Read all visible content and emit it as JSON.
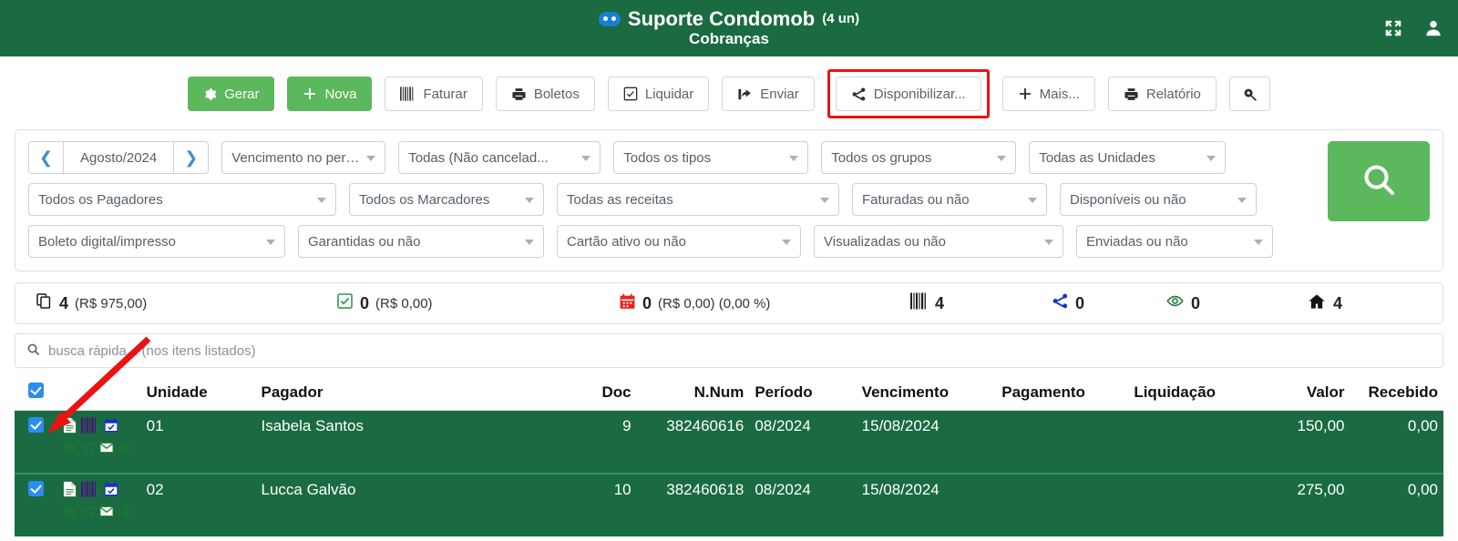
{
  "header": {
    "icon": "game-controller-icon",
    "title": "Suporte Condomob",
    "units": "(4 un)",
    "subtitle": "Cobranças",
    "expand_icon": "expand-arrows-icon",
    "user_icon": "user-icon",
    "bg_color": "#1a6b42"
  },
  "toolbar": {
    "buttons": [
      {
        "label": "Gerar",
        "icon": "gear-icon",
        "style": "green",
        "highlighted": false
      },
      {
        "label": "Nova",
        "icon": "plus-icon",
        "style": "green",
        "highlighted": false
      },
      {
        "label": "Faturar",
        "icon": "barcode-icon",
        "style": "default",
        "highlighted": false
      },
      {
        "label": "Boletos",
        "icon": "printer-icon",
        "style": "default",
        "highlighted": false
      },
      {
        "label": "Liquidar",
        "icon": "checkbox-icon",
        "style": "default",
        "highlighted": false
      },
      {
        "label": "Enviar",
        "icon": "share-out-icon",
        "style": "default",
        "highlighted": false
      },
      {
        "label": "Disponibilizar...",
        "icon": "share-icon",
        "style": "default",
        "highlighted": true
      },
      {
        "label": "Mais...",
        "icon": "plus-icon",
        "style": "default",
        "highlighted": false
      },
      {
        "label": "Relatório",
        "icon": "printer-icon",
        "style": "default",
        "highlighted": false
      },
      {
        "label": "",
        "icon": "search-plus-icon",
        "style": "default",
        "highlighted": false
      }
    ],
    "highlight_color": "#ee1111"
  },
  "filters": {
    "month": "Agosto/2024",
    "prev_icon": "chevron-left-icon",
    "next_icon": "chevron-right-icon",
    "search_button_icon": "search-icon",
    "row1": [
      "Vencimento no perío...",
      "Todas (Não cancelad...",
      "Todos os tipos",
      "Todos os grupos",
      "Todas as Unidades"
    ],
    "row2": [
      "Todos os Pagadores",
      "Todos os Marcadores",
      "Todas as receitas",
      "Faturadas ou não",
      "Disponíveis ou não"
    ],
    "row3": [
      "Boleto digital/impresso",
      "Garantidas ou não",
      "Cartão ativo ou não",
      "Visualizadas ou não",
      "Enviadas ou não"
    ]
  },
  "summary": [
    {
      "icon": "copy-icon",
      "count": "4",
      "detail": "(R$ 975,00)"
    },
    {
      "icon": "check-box-icon",
      "count": "0",
      "detail": "(R$ 0,00)"
    },
    {
      "icon": "calendar-icon",
      "count": "0",
      "detail": "(R$ 0,00) (0,00 %)"
    },
    {
      "icon": "barcode-icon",
      "count": "4",
      "detail": ""
    },
    {
      "icon": "share-icon",
      "count": "0",
      "detail": ""
    },
    {
      "icon": "eye-icon",
      "count": "0",
      "detail": ""
    },
    {
      "icon": "home-icon",
      "count": "4",
      "detail": ""
    }
  ],
  "quick_search": {
    "icon": "search-icon",
    "placeholder": "busca rápida... (nos itens listados)",
    "value": ""
  },
  "table": {
    "header_checkbox_checked": true,
    "columns": [
      {
        "key": "checkbox",
        "label": "",
        "align": "center"
      },
      {
        "key": "icons",
        "label": "",
        "align": "left"
      },
      {
        "key": "unidade",
        "label": "Unidade",
        "align": "left"
      },
      {
        "key": "pagador",
        "label": "Pagador",
        "align": "left"
      },
      {
        "key": "doc",
        "label": "Doc",
        "align": "right"
      },
      {
        "key": "nnum",
        "label": "N.Num",
        "align": "right"
      },
      {
        "key": "periodo",
        "label": "Período",
        "align": "left"
      },
      {
        "key": "vencimento",
        "label": "Vencimento",
        "align": "left"
      },
      {
        "key": "pagamento",
        "label": "Pagamento",
        "align": "left"
      },
      {
        "key": "liquidacao",
        "label": "Liquidação",
        "align": "left"
      },
      {
        "key": "valor",
        "label": "Valor",
        "align": "right"
      },
      {
        "key": "recebido",
        "label": "Recebido",
        "align": "right"
      }
    ],
    "rows": [
      {
        "checked": true,
        "icons_top": [
          "document-icon",
          "barcode-icon",
          "calendar-icon"
        ],
        "icons_bottom": [
          "bank-icon",
          "share-icon",
          "envelope-icon",
          "eye-icon"
        ],
        "unidade": "01",
        "pagador": "Isabela Santos",
        "doc": "9",
        "nnum": "382460616",
        "periodo": "08/2024",
        "vencimento": "15/08/2024",
        "pagamento": "",
        "liquidacao": "",
        "valor": "150,00",
        "recebido": "0,00"
      },
      {
        "checked": true,
        "icons_top": [
          "document-icon",
          "barcode-icon",
          "calendar-icon"
        ],
        "icons_bottom": [
          "bank-icon",
          "share-icon",
          "envelope-icon",
          "eye-icon"
        ],
        "unidade": "02",
        "pagador": "Lucca Galvão",
        "doc": "10",
        "nnum": "382460618",
        "periodo": "08/2024",
        "vencimento": "15/08/2024",
        "pagamento": "",
        "liquidacao": "",
        "valor": "275,00",
        "recebido": "0,00"
      }
    ]
  },
  "annotations": {
    "arrow_color": "#ee1111",
    "arrow_name": "red-pointer-arrow"
  }
}
